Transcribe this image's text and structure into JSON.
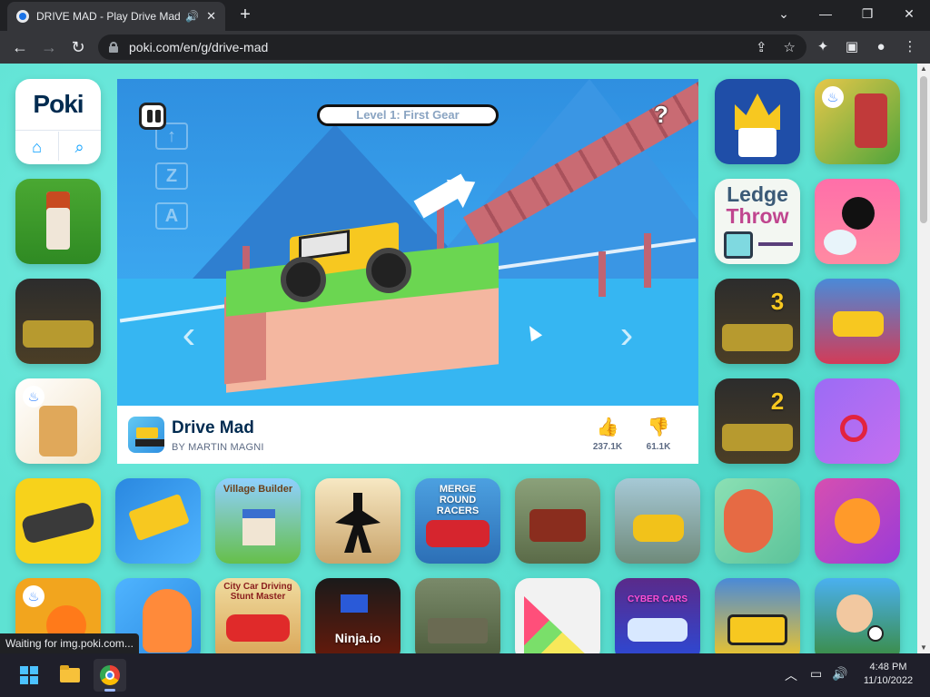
{
  "browser": {
    "tab_title": "DRIVE MAD - Play Drive Mad",
    "url": "poki.com/en/g/drive-mad",
    "status_text": "Waiting for img.poki.com..."
  },
  "sidebar": {
    "logo_text": "Poki"
  },
  "game": {
    "level_label": "Level 1: First Gear",
    "key_hints": [
      "↑",
      "Z",
      "A"
    ],
    "title": "Drive Mad",
    "author": "BY MARTIN MAGNI",
    "likes": "237.1K",
    "dislikes": "61.1K"
  },
  "tiles": {
    "ledge_throw_title_1": "Ledge",
    "ledge_throw_title_2": "Throw",
    "village_builder": "Village Builder",
    "merge_round_racers": "MERGE ROUND RACERS",
    "city_car_driving": "City Car Driving Stunt Master",
    "ninja_io": "Ninja.io",
    "cyber_cars": "CYBER CARS"
  },
  "taskbar": {
    "time": "4:48 PM",
    "date": "11/10/2022"
  },
  "colors": {
    "page_bg": "#5ee2d3",
    "poki_blue": "#009cff",
    "poki_navy": "#002b50"
  }
}
